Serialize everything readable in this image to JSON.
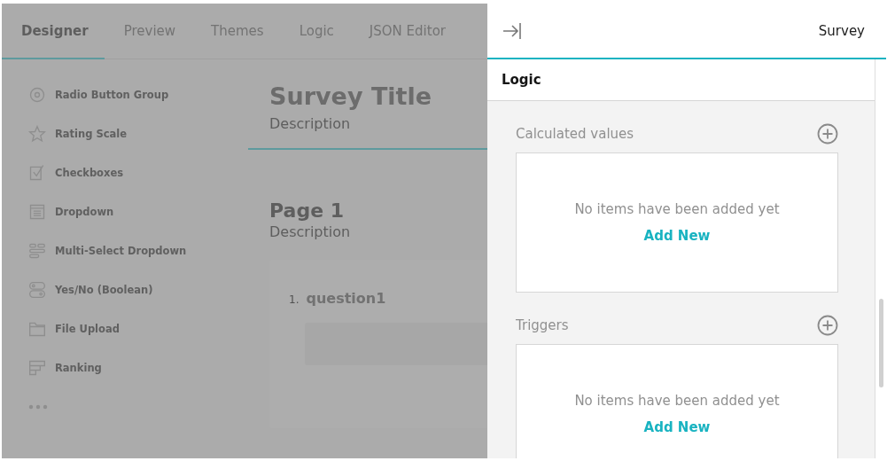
{
  "tabs": [
    {
      "label": "Designer",
      "selected": true
    },
    {
      "label": "Preview",
      "selected": false
    },
    {
      "label": "Themes",
      "selected": false
    },
    {
      "label": "Logic",
      "selected": false
    },
    {
      "label": "JSON Editor",
      "selected": false
    }
  ],
  "toolbox": [
    {
      "kind": "radio",
      "label": "Radio Button Group"
    },
    {
      "kind": "rating",
      "label": "Rating Scale"
    },
    {
      "kind": "checkbox",
      "label": "Checkboxes"
    },
    {
      "kind": "dropdown",
      "label": "Dropdown"
    },
    {
      "kind": "multiselect",
      "label": "Multi-Select Dropdown"
    },
    {
      "kind": "boolean",
      "label": "Yes/No (Boolean)"
    },
    {
      "kind": "file",
      "label": "File Upload"
    },
    {
      "kind": "ranking",
      "label": "Ranking"
    },
    {
      "kind": "more"
    }
  ],
  "survey": {
    "title": "Survey Title",
    "description": "Description"
  },
  "page": {
    "title": "Page 1",
    "description": "Description",
    "question": {
      "number": "1.",
      "title": "question1"
    }
  },
  "property_panel": {
    "title": "Survey",
    "category": "Logic",
    "sections": [
      {
        "title": "Calculated values",
        "empty_text": "No items have been added yet",
        "add_label": "Add New"
      },
      {
        "title": "Triggers",
        "empty_text": "No items have been added yet",
        "add_label": "Add New"
      }
    ]
  }
}
